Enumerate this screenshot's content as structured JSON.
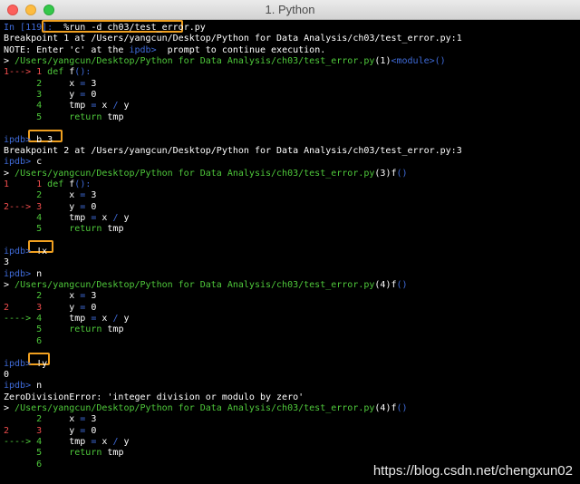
{
  "window": {
    "title": "1. Python"
  },
  "colors": {
    "background": "#000000",
    "prompt_blue": "#3f6bd9",
    "path_green": "#4fc93b",
    "arrow_red": "#f04d4d",
    "highlight_orange": "#f0a020"
  },
  "lines": [
    {
      "segments": [
        {
          "text": "In [",
          "color": "c-blue"
        },
        {
          "text": "119",
          "color": "c-blue"
        },
        {
          "text": "]: ",
          "color": "c-blue"
        },
        {
          "text": " %run -d ch03/test_error.py",
          "color": "c-white"
        }
      ]
    },
    {
      "segments": [
        {
          "text": "Breakpoint 1 at /Users/yangcun/Desktop/Python for Data Analysis/ch03/test_error.py:1",
          "color": "c-white"
        }
      ]
    },
    {
      "segments": [
        {
          "text": "NOTE: Enter 'c' at the ",
          "color": "c-white"
        },
        {
          "text": "ipdb>",
          "color": "c-blue"
        },
        {
          "text": "  prompt to continue execution.",
          "color": "c-white"
        }
      ]
    },
    {
      "segments": [
        {
          "text": "> ",
          "color": "c-white"
        },
        {
          "text": "/Users/yangcun/Desktop/Python for Data Analysis/ch03/test_error.py",
          "color": "c-green"
        },
        {
          "text": "(1)",
          "color": "c-white"
        },
        {
          "text": "<module>",
          "color": "c-blue"
        },
        {
          "text": "()",
          "color": "c-blue"
        }
      ]
    },
    {
      "segments": [
        {
          "text": "1---> 1 ",
          "color": "c-red"
        },
        {
          "text": "def ",
          "color": "c-green"
        },
        {
          "text": "f",
          "color": "c-white"
        },
        {
          "text": "():",
          "color": "c-blue"
        }
      ]
    },
    {
      "segments": [
        {
          "text": "      2     ",
          "color": "c-green"
        },
        {
          "text": "x ",
          "color": "c-white"
        },
        {
          "text": "= ",
          "color": "c-blue"
        },
        {
          "text": "3",
          "color": "c-white"
        }
      ]
    },
    {
      "segments": [
        {
          "text": "      3     ",
          "color": "c-green"
        },
        {
          "text": "y ",
          "color": "c-white"
        },
        {
          "text": "= ",
          "color": "c-blue"
        },
        {
          "text": "0",
          "color": "c-white"
        }
      ]
    },
    {
      "segments": [
        {
          "text": "      4     ",
          "color": "c-green"
        },
        {
          "text": "tmp ",
          "color": "c-white"
        },
        {
          "text": "= ",
          "color": "c-blue"
        },
        {
          "text": "x ",
          "color": "c-white"
        },
        {
          "text": "/ ",
          "color": "c-blue"
        },
        {
          "text": "y",
          "color": "c-white"
        }
      ]
    },
    {
      "segments": [
        {
          "text": "      5     ",
          "color": "c-green"
        },
        {
          "text": "return ",
          "color": "c-green"
        },
        {
          "text": "tmp",
          "color": "c-white"
        }
      ]
    },
    {
      "segments": []
    },
    {
      "segments": [
        {
          "text": "ipdb> ",
          "color": "c-blue"
        },
        {
          "text": "b 3",
          "color": "c-white"
        }
      ]
    },
    {
      "segments": [
        {
          "text": "Breakpoint 2 at /Users/yangcun/Desktop/Python for Data Analysis/ch03/test_error.py:3",
          "color": "c-white"
        }
      ]
    },
    {
      "segments": [
        {
          "text": "ipdb> ",
          "color": "c-blue"
        },
        {
          "text": "c",
          "color": "c-white"
        }
      ]
    },
    {
      "segments": [
        {
          "text": "> ",
          "color": "c-white"
        },
        {
          "text": "/Users/yangcun/Desktop/Python for Data Analysis/ch03/test_error.py",
          "color": "c-green"
        },
        {
          "text": "(3)",
          "color": "c-white"
        },
        {
          "text": "f",
          "color": "c-white"
        },
        {
          "text": "()",
          "color": "c-blue"
        }
      ]
    },
    {
      "segments": [
        {
          "text": "1     1 ",
          "color": "c-red"
        },
        {
          "text": "def ",
          "color": "c-green"
        },
        {
          "text": "f",
          "color": "c-white"
        },
        {
          "text": "():",
          "color": "c-blue"
        }
      ]
    },
    {
      "segments": [
        {
          "text": "      2     ",
          "color": "c-green"
        },
        {
          "text": "x ",
          "color": "c-white"
        },
        {
          "text": "= ",
          "color": "c-blue"
        },
        {
          "text": "3",
          "color": "c-white"
        }
      ]
    },
    {
      "segments": [
        {
          "text": "2---> 3     ",
          "color": "c-red"
        },
        {
          "text": "y ",
          "color": "c-white"
        },
        {
          "text": "= ",
          "color": "c-blue"
        },
        {
          "text": "0",
          "color": "c-white"
        }
      ]
    },
    {
      "segments": [
        {
          "text": "      4     ",
          "color": "c-green"
        },
        {
          "text": "tmp ",
          "color": "c-white"
        },
        {
          "text": "= ",
          "color": "c-blue"
        },
        {
          "text": "x ",
          "color": "c-white"
        },
        {
          "text": "/ ",
          "color": "c-blue"
        },
        {
          "text": "y",
          "color": "c-white"
        }
      ]
    },
    {
      "segments": [
        {
          "text": "      5     ",
          "color": "c-green"
        },
        {
          "text": "return ",
          "color": "c-green"
        },
        {
          "text": "tmp",
          "color": "c-white"
        }
      ]
    },
    {
      "segments": []
    },
    {
      "segments": [
        {
          "text": "ipdb> ",
          "color": "c-blue"
        },
        {
          "text": "!x",
          "color": "c-white"
        }
      ]
    },
    {
      "segments": [
        {
          "text": "3",
          "color": "c-white"
        }
      ]
    },
    {
      "segments": [
        {
          "text": "ipdb> ",
          "color": "c-blue"
        },
        {
          "text": "n",
          "color": "c-white"
        }
      ]
    },
    {
      "segments": [
        {
          "text": "> ",
          "color": "c-white"
        },
        {
          "text": "/Users/yangcun/Desktop/Python for Data Analysis/ch03/test_error.py",
          "color": "c-green"
        },
        {
          "text": "(4)",
          "color": "c-white"
        },
        {
          "text": "f",
          "color": "c-white"
        },
        {
          "text": "()",
          "color": "c-blue"
        }
      ]
    },
    {
      "segments": [
        {
          "text": "      2     ",
          "color": "c-green"
        },
        {
          "text": "x ",
          "color": "c-white"
        },
        {
          "text": "= ",
          "color": "c-blue"
        },
        {
          "text": "3",
          "color": "c-white"
        }
      ]
    },
    {
      "segments": [
        {
          "text": "2     3     ",
          "color": "c-red"
        },
        {
          "text": "y ",
          "color": "c-white"
        },
        {
          "text": "= ",
          "color": "c-blue"
        },
        {
          "text": "0",
          "color": "c-white"
        }
      ]
    },
    {
      "segments": [
        {
          "text": "----> 4     ",
          "color": "c-green"
        },
        {
          "text": "tmp ",
          "color": "c-white"
        },
        {
          "text": "= ",
          "color": "c-blue"
        },
        {
          "text": "x ",
          "color": "c-white"
        },
        {
          "text": "/ ",
          "color": "c-blue"
        },
        {
          "text": "y",
          "color": "c-white"
        }
      ]
    },
    {
      "segments": [
        {
          "text": "      5     ",
          "color": "c-green"
        },
        {
          "text": "return ",
          "color": "c-green"
        },
        {
          "text": "tmp",
          "color": "c-white"
        }
      ]
    },
    {
      "segments": [
        {
          "text": "      6",
          "color": "c-green"
        }
      ]
    },
    {
      "segments": []
    },
    {
      "segments": [
        {
          "text": "ipdb> ",
          "color": "c-blue"
        },
        {
          "text": "!y",
          "color": "c-white"
        }
      ]
    },
    {
      "segments": [
        {
          "text": "0",
          "color": "c-white"
        }
      ]
    },
    {
      "segments": [
        {
          "text": "ipdb> ",
          "color": "c-blue"
        },
        {
          "text": "n",
          "color": "c-white"
        }
      ]
    },
    {
      "segments": [
        {
          "text": "ZeroDivisionError: 'integer division or modulo by zero'",
          "color": "c-white"
        }
      ]
    },
    {
      "segments": [
        {
          "text": "> ",
          "color": "c-white"
        },
        {
          "text": "/Users/yangcun/Desktop/Python for Data Analysis/ch03/test_error.py",
          "color": "c-green"
        },
        {
          "text": "(4)",
          "color": "c-white"
        },
        {
          "text": "f",
          "color": "c-white"
        },
        {
          "text": "()",
          "color": "c-blue"
        }
      ]
    },
    {
      "segments": [
        {
          "text": "      2     ",
          "color": "c-green"
        },
        {
          "text": "x ",
          "color": "c-white"
        },
        {
          "text": "= ",
          "color": "c-blue"
        },
        {
          "text": "3",
          "color": "c-white"
        }
      ]
    },
    {
      "segments": [
        {
          "text": "2     3     ",
          "color": "c-red"
        },
        {
          "text": "y ",
          "color": "c-white"
        },
        {
          "text": "= ",
          "color": "c-blue"
        },
        {
          "text": "0",
          "color": "c-white"
        }
      ]
    },
    {
      "segments": [
        {
          "text": "----> 4     ",
          "color": "c-green"
        },
        {
          "text": "tmp ",
          "color": "c-white"
        },
        {
          "text": "= ",
          "color": "c-blue"
        },
        {
          "text": "x ",
          "color": "c-white"
        },
        {
          "text": "/ ",
          "color": "c-blue"
        },
        {
          "text": "y",
          "color": "c-white"
        }
      ]
    },
    {
      "segments": [
        {
          "text": "      5     ",
          "color": "c-green"
        },
        {
          "text": "return ",
          "color": "c-green"
        },
        {
          "text": "tmp",
          "color": "c-white"
        }
      ]
    },
    {
      "segments": [
        {
          "text": "      6",
          "color": "c-green"
        }
      ]
    }
  ],
  "watermark": "https://blog.csdn.net/chengxun02"
}
